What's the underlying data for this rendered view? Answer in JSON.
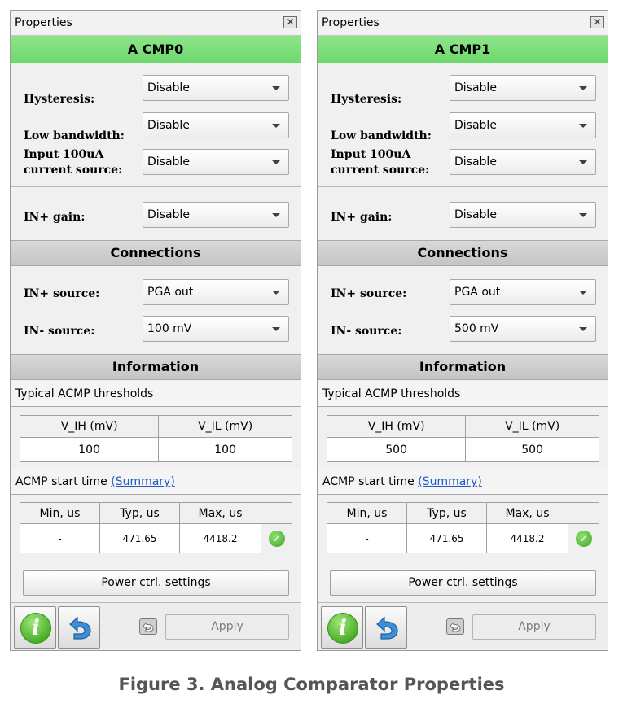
{
  "panels": [
    {
      "title": "Properties",
      "header": "A CMP0",
      "hysteresis_label": "Hysteresis:",
      "hysteresis_value": "Disable",
      "lowbw_label": "Low bandwidth:",
      "lowbw_value": "Disable",
      "input_label_line1": "Input 100uA",
      "input_label_line2": "current source:",
      "input_value": "Disable",
      "gain_label": "IN+ gain:",
      "gain_value": "Disable",
      "connections_title": "Connections",
      "inplus_label": "IN+ source:",
      "inplus_value": "PGA out",
      "inminus_label": "IN- source:",
      "inminus_value": "100 mV",
      "information_title": "Information",
      "thresholds_title": "Typical ACMP thresholds",
      "thr_headers": [
        "V_IH (mV)",
        "V_IL (mV)"
      ],
      "thr_values": [
        "100",
        "100"
      ],
      "start_time_label": "ACMP start time",
      "summary_link": "(Summary)",
      "st_headers": [
        "Min, us",
        "Typ, us",
        "Max, us"
      ],
      "st_values": [
        "-",
        "471.65",
        "4418.2"
      ],
      "power_button": "Power ctrl. settings",
      "apply_button": "Apply"
    },
    {
      "title": "Properties",
      "header": "A CMP1",
      "hysteresis_label": "Hysteresis:",
      "hysteresis_value": "Disable",
      "lowbw_label": "Low bandwidth:",
      "lowbw_value": "Disable",
      "input_label_line1": "Input 100uA",
      "input_label_line2": "current source:",
      "input_value": "Disable",
      "gain_label": "IN+ gain:",
      "gain_value": "Disable",
      "connections_title": "Connections",
      "inplus_label": "IN+ source:",
      "inplus_value": "PGA out",
      "inminus_label": "IN- source:",
      "inminus_value": "500 mV",
      "information_title": "Information",
      "thresholds_title": "Typical ACMP thresholds",
      "thr_headers": [
        "V_IH (mV)",
        "V_IL (mV)"
      ],
      "thr_values": [
        "500",
        "500"
      ],
      "start_time_label": "ACMP start time",
      "summary_link": "(Summary)",
      "st_headers": [
        "Min, us",
        "Typ, us",
        "Max, us"
      ],
      "st_values": [
        "-",
        "471.65",
        "4418.2"
      ],
      "power_button": "Power ctrl. settings",
      "apply_button": "Apply"
    }
  ],
  "caption": "Figure 3. Analog Comparator Properties",
  "icons": {
    "close": "close-icon",
    "dropdown": "chevron-down-icon",
    "status": "checkmark-icon",
    "info": "info-icon",
    "undo": "undo-icon"
  },
  "colors": {
    "header_green": "#7ddc7a",
    "section_gray": "#cdcdcd",
    "link_blue": "#1f5cc7",
    "ok_green": "#4bb035"
  }
}
